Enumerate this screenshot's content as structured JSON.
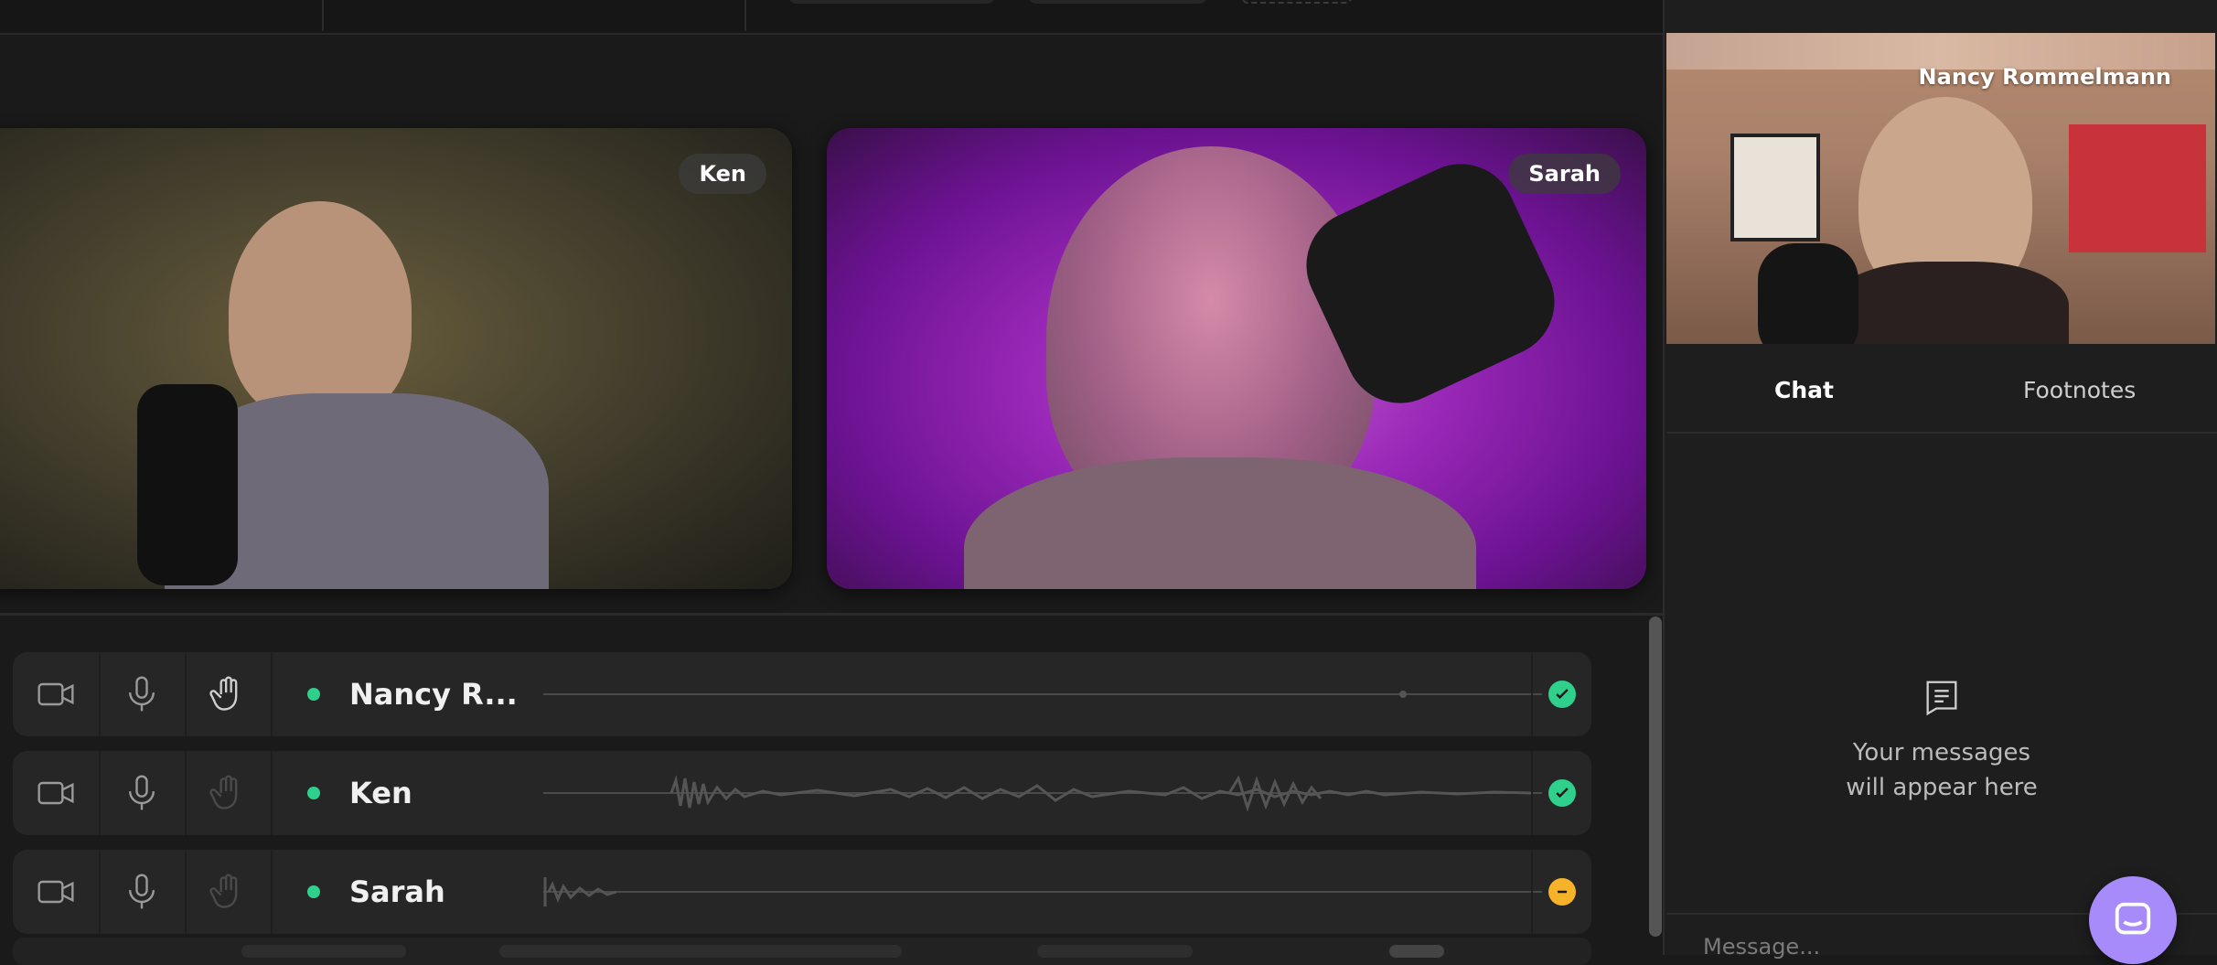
{
  "participants_tiles": [
    {
      "name": "Ken"
    },
    {
      "name": "Sarah"
    }
  ],
  "self_view": {
    "name": "Nancy Rommelmann"
  },
  "participant_list": [
    {
      "name": "Nancy R...",
      "status": "ready"
    },
    {
      "name": "Ken",
      "status": "ready"
    },
    {
      "name": "Sarah",
      "status": "away"
    }
  ],
  "sidebar": {
    "tabs": [
      {
        "label": "Chat",
        "active": true
      },
      {
        "label": "Footnotes",
        "active": false
      }
    ],
    "empty_state": {
      "line1": "Your messages",
      "line2": "will appear here"
    },
    "message_placeholder": "Message..."
  },
  "colors": {
    "online": "#2fd08c",
    "ready": "#2fd08c",
    "away": "#f6b329",
    "accent": "#a78bfa"
  }
}
